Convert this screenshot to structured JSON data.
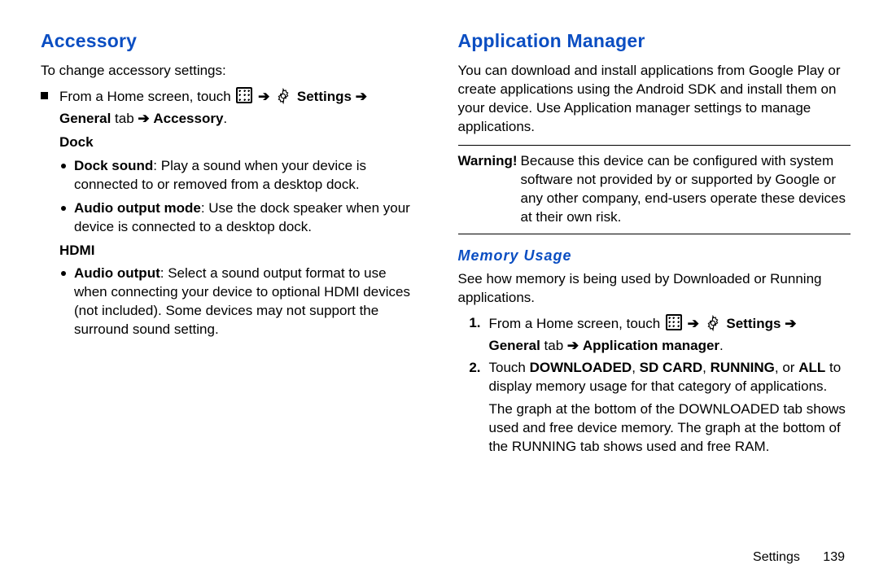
{
  "left": {
    "heading": "Accessory",
    "intro": "To change accessory settings:",
    "nav_prefix": "From a Home screen, touch",
    "nav_settings": "Settings",
    "nav_tab": "General",
    "nav_tab_suffix": " tab",
    "nav_dest": "Accessory",
    "nav_arrow": "➔",
    "sec1": "Dock",
    "s1b1_t": "Dock sound",
    "s1b1_b": ": Play a sound when your device is connected to or removed from a desktop dock.",
    "s1b2_t": "Audio output mode",
    "s1b2_b": ": Use the dock speaker when your device is connected to a desktop dock.",
    "sec2": "HDMI",
    "s2b1_t": "Audio output",
    "s2b1_b": ": Select a sound output format to use when connecting your device to optional HDMI devices (not included). Some devices may not support the surround sound setting."
  },
  "right": {
    "heading": "Application Manager",
    "intro": "You can download and install applications from Google Play or create applications using the Android SDK and install them on your device. Use Application manager settings to manage applications.",
    "warn_label": "Warning!",
    "warn_body": "Because this device can be configured with system software not provided by or supported by Google or any other company, end-users operate these devices at their own risk.",
    "sub_heading": "Memory Usage",
    "sub_intro": "See how memory is being used by Downloaded or Running applications.",
    "step1_num": "1.",
    "step1_prefix": "From a Home screen, touch",
    "step1_settings": "Settings",
    "step1_tab": "General",
    "step1_tab_suffix": " tab",
    "step1_dest": "Application manager",
    "nav_arrow": "➔",
    "step2_num": "2.",
    "step2_a": "Touch ",
    "step2_d": "DOWNLOADED",
    "step2_sd": "SD CARD",
    "step2_r": "RUNNING",
    "step2_all": "ALL",
    "step2_b": " to display memory usage for that category of applications.",
    "step_extra": "The graph at the bottom of the DOWNLOADED tab shows used and free device memory. The graph at the bottom of the RUNNING tab shows used and free RAM."
  },
  "footer": {
    "section": "Settings",
    "page": "139"
  }
}
